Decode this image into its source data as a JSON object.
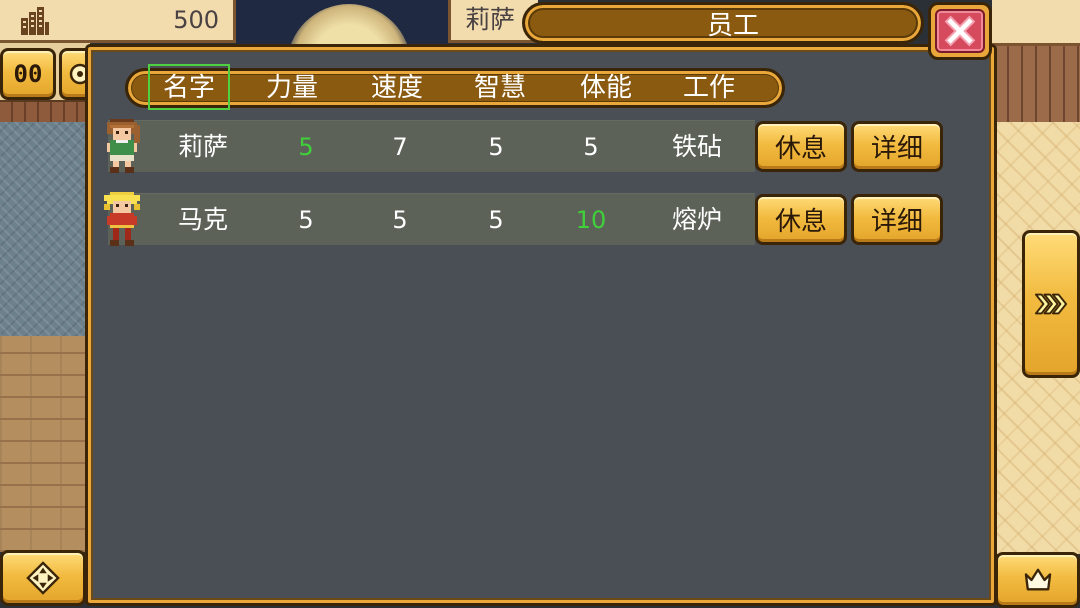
{
  "hud": {
    "resource_icon": "building-icon",
    "resource_value": "500",
    "speed_button_label": "00",
    "settings_icon": "settings-icon",
    "move_icon": "dpad-icon",
    "next_icon": "chevron-right-icon",
    "menu_icon": "crown-icon"
  },
  "background_tab": {
    "label": "莉萨"
  },
  "window": {
    "title": "员工",
    "close_icon": "close-icon"
  },
  "columns": [
    {
      "label": "名字",
      "selected": true
    },
    {
      "label": "力量",
      "selected": false
    },
    {
      "label": "速度",
      "selected": false
    },
    {
      "label": "智慧",
      "selected": false
    },
    {
      "label": "体能",
      "selected": false
    },
    {
      "label": "工作",
      "selected": false
    }
  ],
  "employees": [
    {
      "name": "莉萨",
      "avatar": "girl-avatar-icon",
      "stats": [
        {
          "value": "5",
          "highlight": true
        },
        {
          "value": "7",
          "highlight": false
        },
        {
          "value": "5",
          "highlight": false
        },
        {
          "value": "5",
          "highlight": false
        }
      ],
      "job": "铁砧",
      "rest_label": "休息",
      "detail_label": "详细"
    },
    {
      "name": "马克",
      "avatar": "boy-avatar-icon",
      "stats": [
        {
          "value": "5",
          "highlight": false
        },
        {
          "value": "5",
          "highlight": false
        },
        {
          "value": "5",
          "highlight": false
        },
        {
          "value": "10",
          "highlight": true
        }
      ],
      "job": "熔炉",
      "rest_label": "休息",
      "detail_label": "详细"
    }
  ],
  "colors": {
    "panel": "#4a4f55",
    "row": "#5d6259",
    "gold": "#eaa83a",
    "brown": "#8a5a10",
    "text": "#ffffff",
    "highlight": "#3fd03a",
    "selection": "#4ed040"
  }
}
